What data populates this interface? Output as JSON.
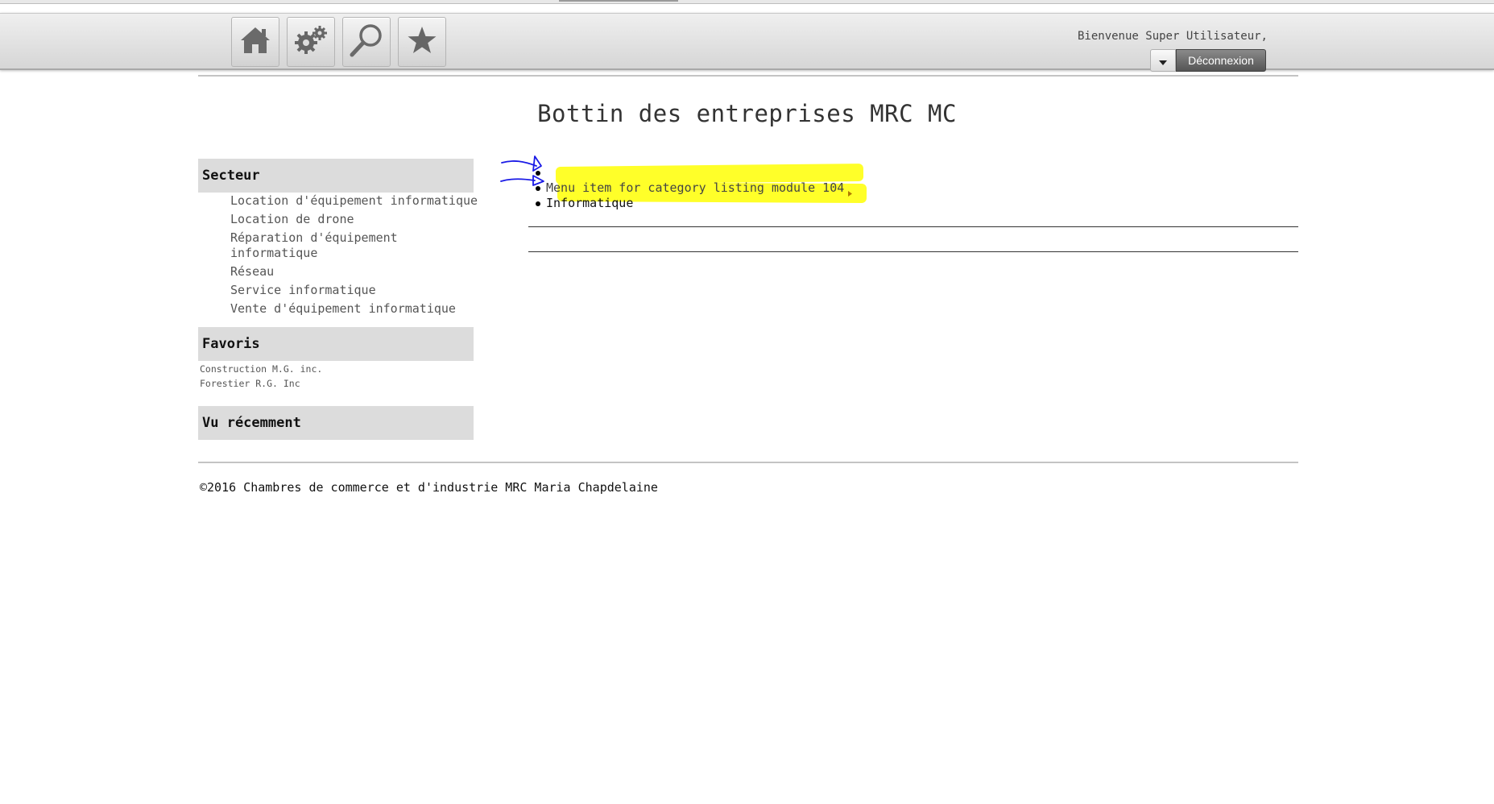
{
  "toolbar": {
    "buttons": [
      {
        "name": "home",
        "icon": "home-icon"
      },
      {
        "name": "settings",
        "icon": "gears-icon"
      },
      {
        "name": "search",
        "icon": "search-icon"
      },
      {
        "name": "favorites",
        "icon": "star-icon"
      }
    ],
    "welcome_text": "Bienvenue Super Utilisateur,",
    "logout_label": "Déconnexion"
  },
  "page_title": "Bottin des entreprises MRC MC",
  "sidebar": {
    "sector": {
      "title": "Secteur",
      "items": [
        "Location d'équipement informatique",
        "Location de drone",
        "Réparation d'équipement informatique",
        "Réseau",
        "Service informatique",
        "Vente d'équipement informatique"
      ]
    },
    "favorites": {
      "title": "Favoris",
      "items": [
        "Construction M.G. inc.",
        "Forestier R.G. Inc"
      ]
    },
    "recent": {
      "title": "Vu récemment"
    }
  },
  "main": {
    "list": [
      {
        "text": ""
      },
      {
        "text": "Menu item for category listing module 104"
      },
      {
        "text": "Informatique"
      }
    ],
    "highlight_color": "#ffff29",
    "annotation_color": "#1a1ae6"
  },
  "footer": "©2016 Chambres de commerce et d'industrie MRC Maria Chapdelaine"
}
